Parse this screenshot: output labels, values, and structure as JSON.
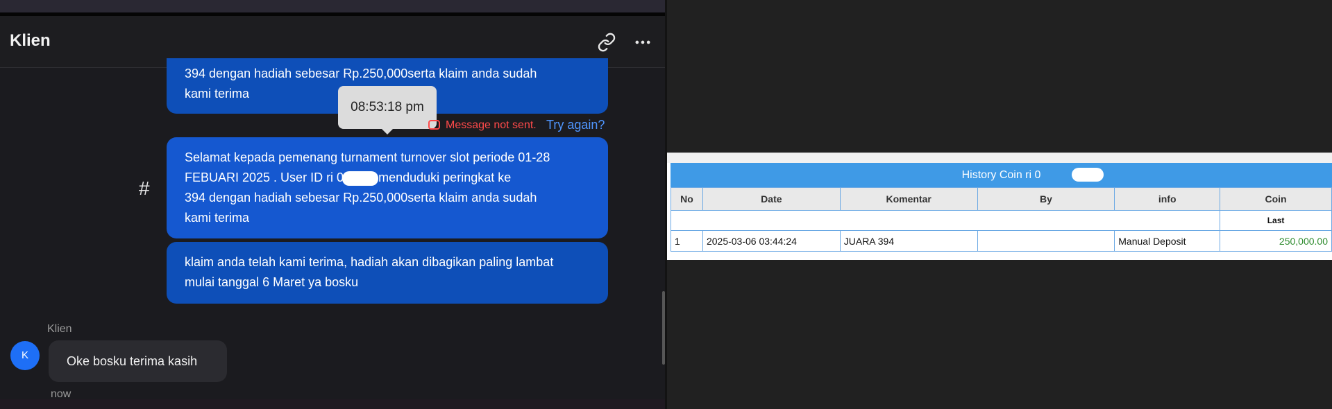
{
  "header": {
    "title": "Klien",
    "link_icon": "link-icon",
    "more_icon": "more-horizontal-icon"
  },
  "messages": [
    {
      "lines": [
        "394 dengan hadiah sebesar Rp.250,000serta klaim anda sudah",
        "kami terima"
      ]
    },
    {
      "lines": [
        "Selamat kepada pemenang turnament turnover slot periode 01-28",
        "FEBUARI 2025 . User ID ri       0 anda menduduki peringkat ke",
        "394 dengan hadiah sebesar Rp.250,000serta klaim anda sudah",
        "kami terima"
      ]
    },
    {
      "lines": [
        "klaim anda telah kami terima, hadiah akan dibagikan paling lambat",
        "mulai tanggal 6 Maret ya bosku"
      ]
    }
  ],
  "tooltip": {
    "time": "08:53:18 pm"
  },
  "status": {
    "error": "Message not sent.",
    "retry": "Try again?",
    "error_icon": "warning-icon"
  },
  "channel_icon": "#",
  "incoming": {
    "sender": "Klien",
    "avatar_letter": "K",
    "text": "Oke bosku terima kasih",
    "time": "now"
  },
  "report": {
    "title": "History Coin ri       0",
    "columns": [
      "No",
      "Date",
      "Komentar",
      "By",
      "info",
      "Coin"
    ],
    "subheader": "Last",
    "rows": [
      {
        "no": "1",
        "date": "2025-03-06 03:44:24",
        "komentar": "JUARA 394",
        "by": "",
        "info": "Manual Deposit",
        "coin": "250,000.00"
      }
    ],
    "coin_color": "#2e8b2e"
  },
  "colors": {
    "sent_bubble": "#0e4fb8",
    "selected_bubble": "#1558d0",
    "error": "#ff4a4a",
    "retry": "#4f96ff",
    "report_header": "#3f9ae6"
  }
}
